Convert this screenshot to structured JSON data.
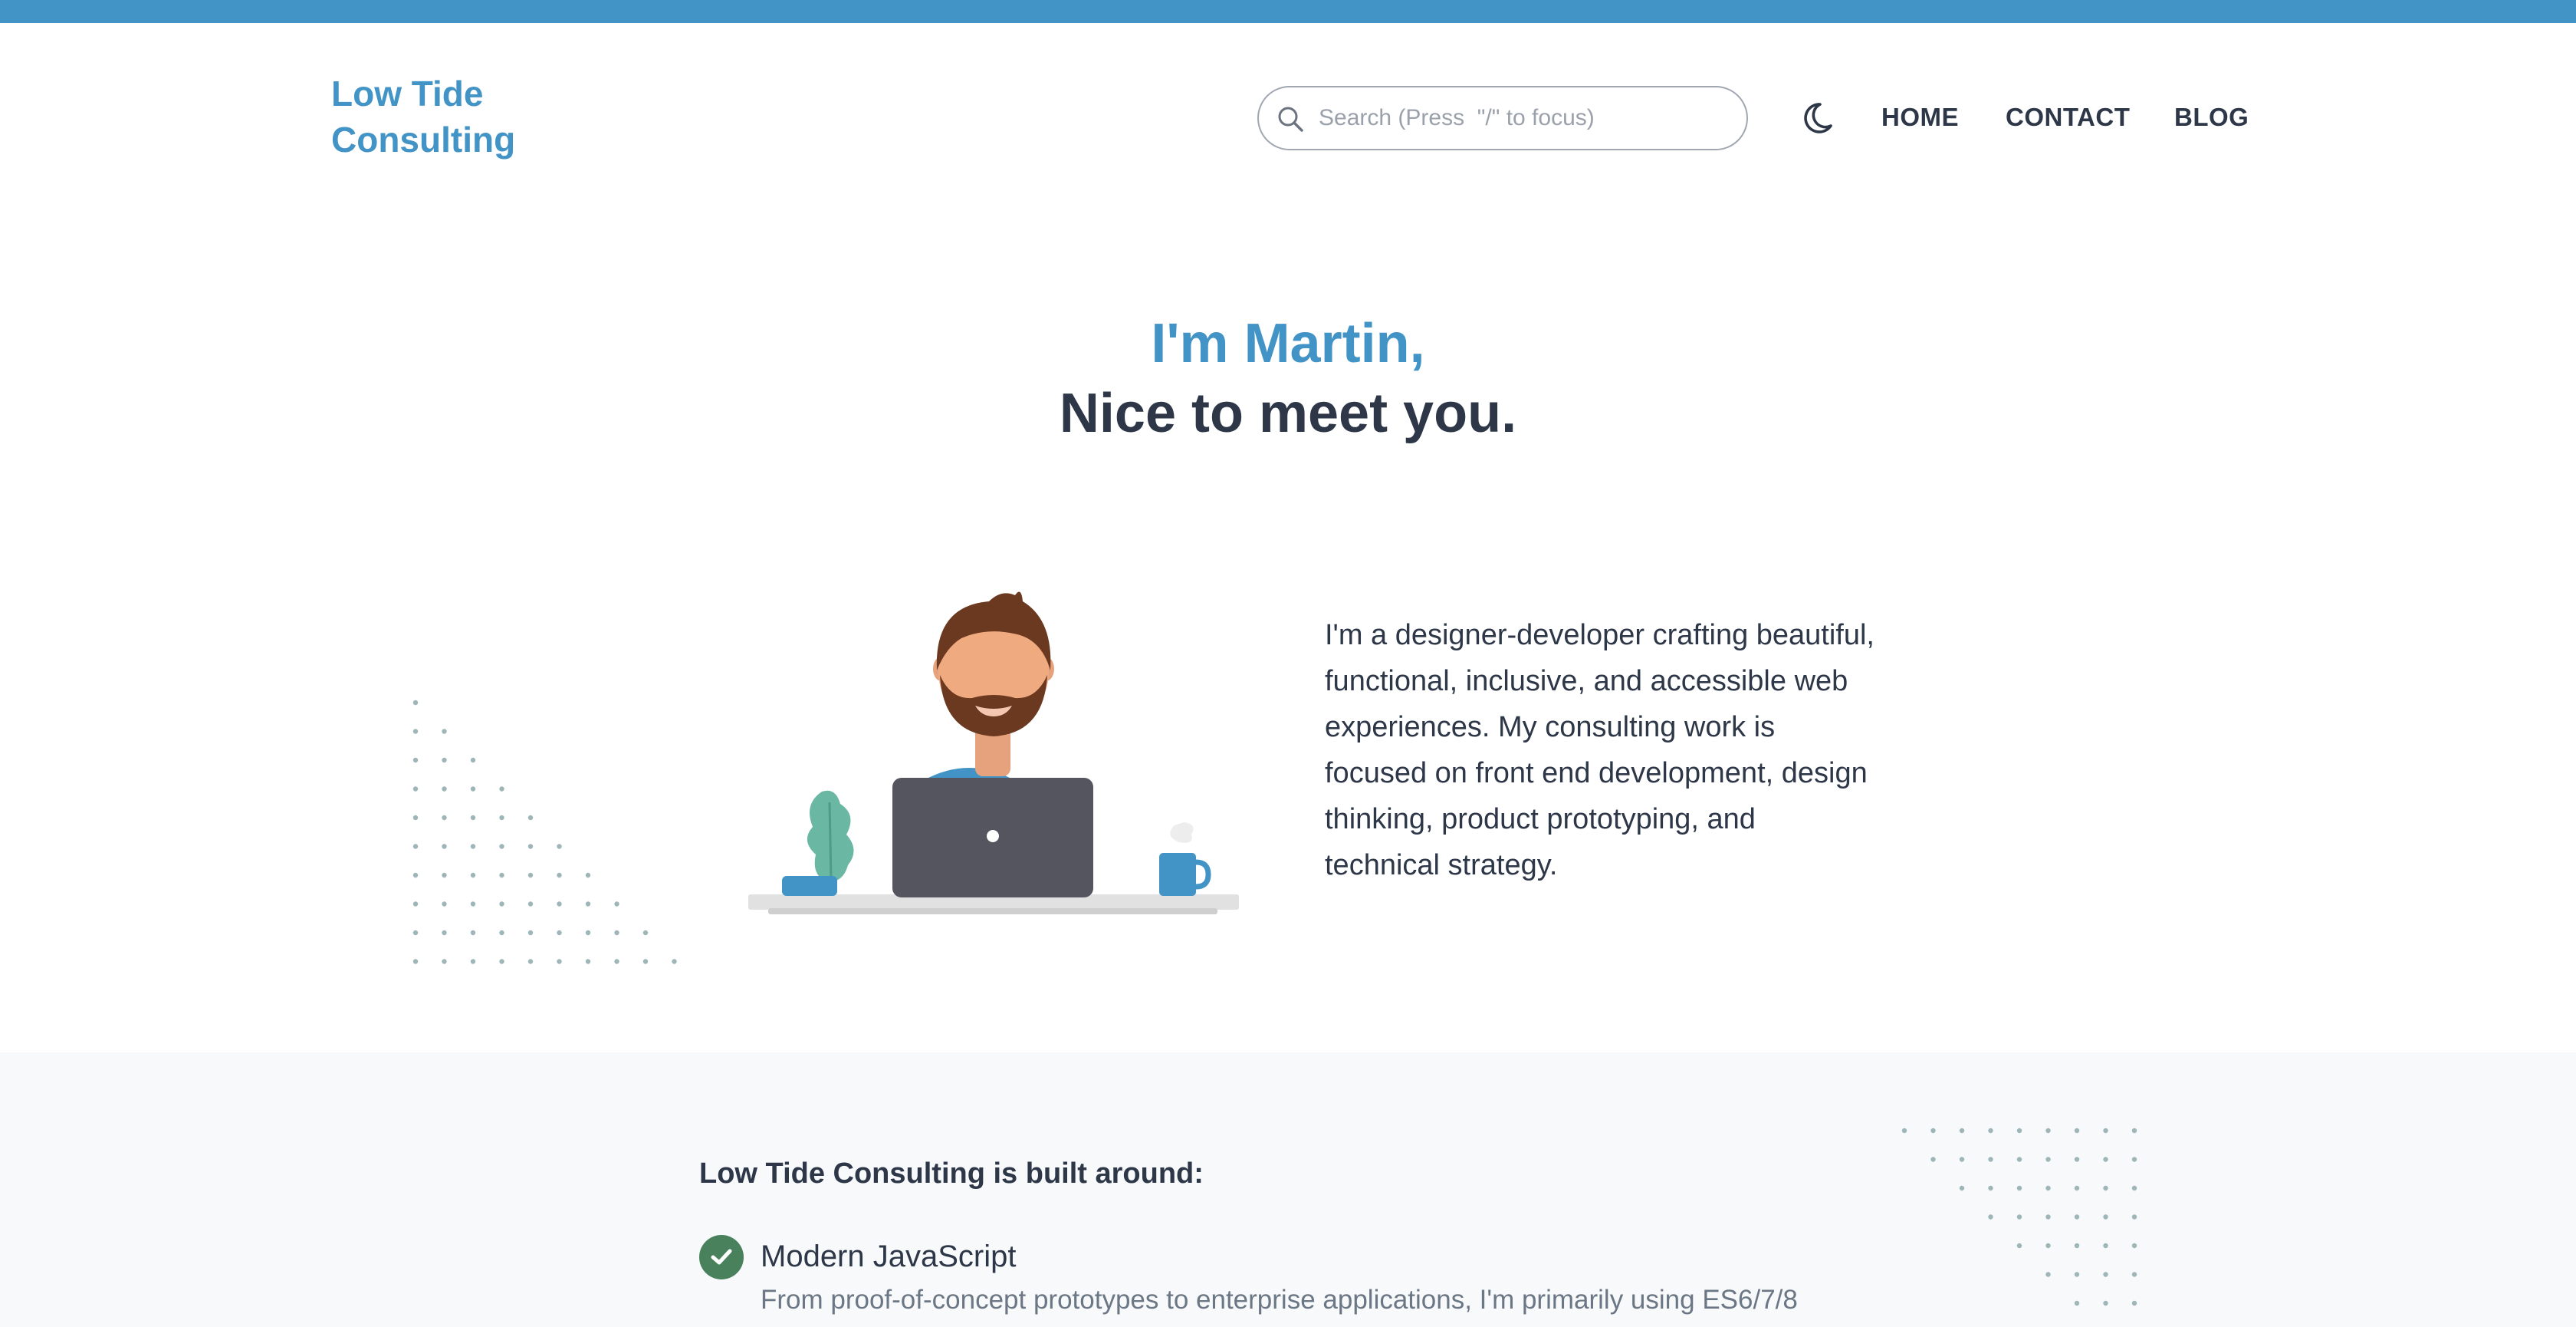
{
  "site": {
    "logo_line1": "Low Tide",
    "logo_line2": "Consulting",
    "accent_color": "#4293c6"
  },
  "header": {
    "search_placeholder": "Search (Press  \"/\" to focus)",
    "search_icon": "search-icon",
    "theme_toggle_icon": "moon-icon",
    "nav": [
      {
        "label": "HOME"
      },
      {
        "label": "CONTACT"
      },
      {
        "label": "BLOG"
      }
    ]
  },
  "hero": {
    "greeting": "I'm Martin,",
    "subtitle": "Nice to meet you.",
    "bio": "I'm a designer-developer crafting beautiful, functional, inclusive, and accessible web experiences. My consulting work is focused on front end development, design thinking, product prototyping, and technical strategy."
  },
  "features": {
    "title": "Low Tide Consulting is built around:",
    "items": [
      {
        "icon": "check-circle-icon",
        "title": "Modern JavaScript",
        "description": "From proof-of-concept prototypes to enterprise applications, I'm primarily using ES6/7/8"
      }
    ]
  }
}
